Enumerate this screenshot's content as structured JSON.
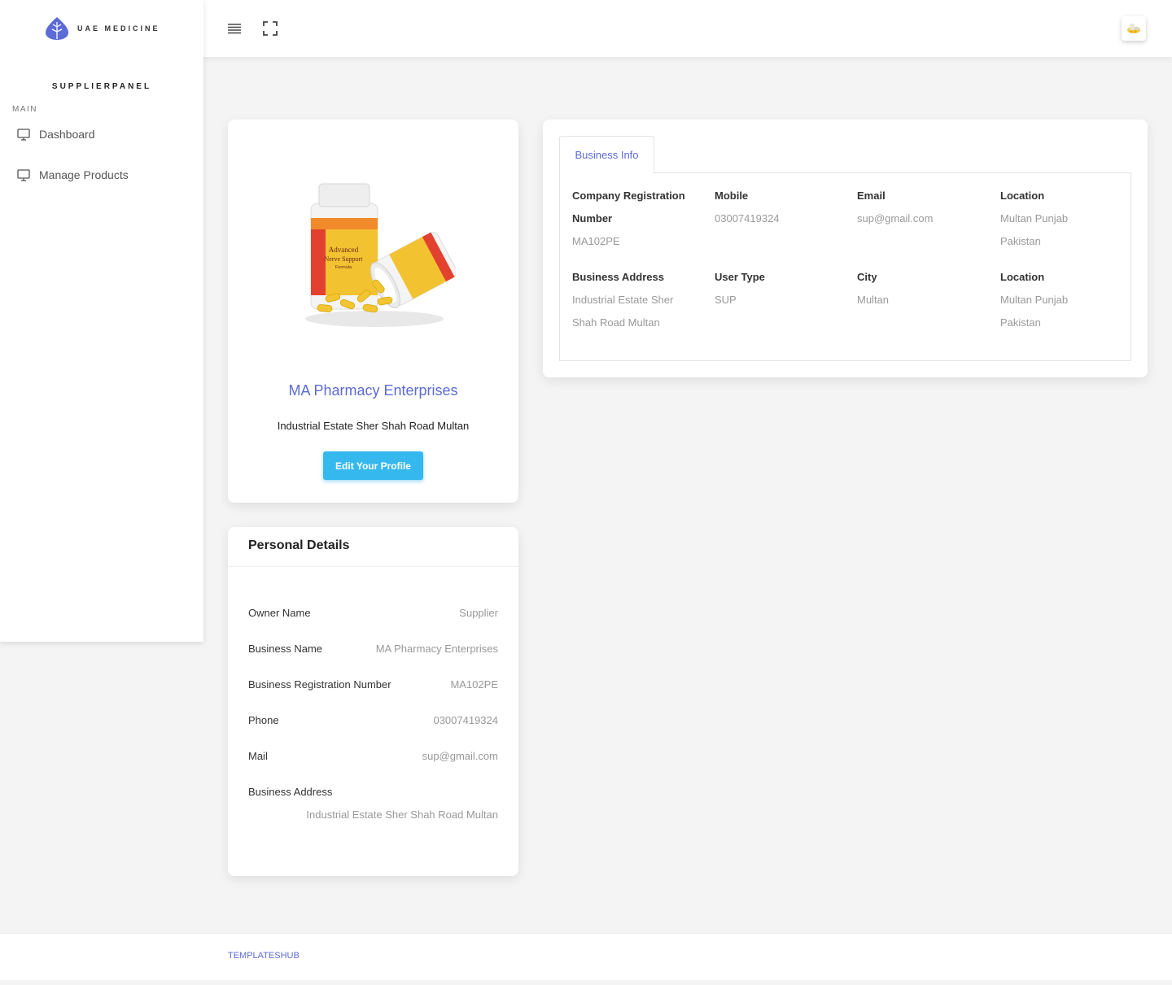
{
  "brand": {
    "name": "UAE MEDICINE",
    "logo_icon": "leaf-icon",
    "accent": "#5c6bd6"
  },
  "sidebar": {
    "panel_title": "SUPPLIERPANEL",
    "section_label": "MAIN",
    "items": [
      {
        "label": "Dashboard",
        "icon": "monitor-icon"
      },
      {
        "label": "Manage Products",
        "icon": "monitor-icon"
      }
    ]
  },
  "topbar": {
    "menu_icon": "hamburger-icon",
    "fullscreen_icon": "fullscreen-icon",
    "avatar_icon": "avatar"
  },
  "profile": {
    "company_name": "MA Pharmacy Enterprises",
    "address": "Industrial Estate Sher Shah Road Multan",
    "edit_button": "Edit Your Profile",
    "button_color": "#35b8ee",
    "product_label": [
      "Advanced",
      "Nerve Support",
      "Formula"
    ]
  },
  "personal": {
    "title": "Personal Details",
    "rows": [
      {
        "label": "Owner Name",
        "value": "Supplier"
      },
      {
        "label": "Business Name",
        "value": "MA Pharmacy Enterprises"
      },
      {
        "label": "Business Registration Number",
        "value": "MA102PE"
      },
      {
        "label": "Phone",
        "value": "03007419324"
      },
      {
        "label": "Mail",
        "value": "sup@gmail.com"
      },
      {
        "label": "Business Address",
        "value": "Industrial Estate Sher Shah Road Multan"
      }
    ]
  },
  "business": {
    "tab_label": "Business Info",
    "row1": [
      {
        "label_line1": "Company Registration",
        "label_line2": "Number",
        "value_line1": "MA102PE",
        "value_line2": ""
      },
      {
        "label_line1": "Mobile",
        "label_line2": "",
        "value_line1": "03007419324",
        "value_line2": ""
      },
      {
        "label_line1": "Email",
        "label_line2": "",
        "value_line1": "sup@gmail.com",
        "value_line2": ""
      },
      {
        "label_line1": "Location",
        "label_line2": "",
        "value_line1": "Multan Punjab",
        "value_line2": "Pakistan"
      }
    ],
    "row2": [
      {
        "label": "Business Address",
        "value_line1": "Industrial Estate Sher",
        "value_line2": "Shah Road Multan"
      },
      {
        "label": "User Type",
        "value_line1": "SUP",
        "value_line2": ""
      },
      {
        "label": "City",
        "value_line1": "Multan",
        "value_line2": ""
      },
      {
        "label": "Location",
        "value_line1": "Multan Punjab",
        "value_line2": "Pakistan"
      }
    ]
  },
  "footer": {
    "text": "TEMPLATESHUB"
  }
}
